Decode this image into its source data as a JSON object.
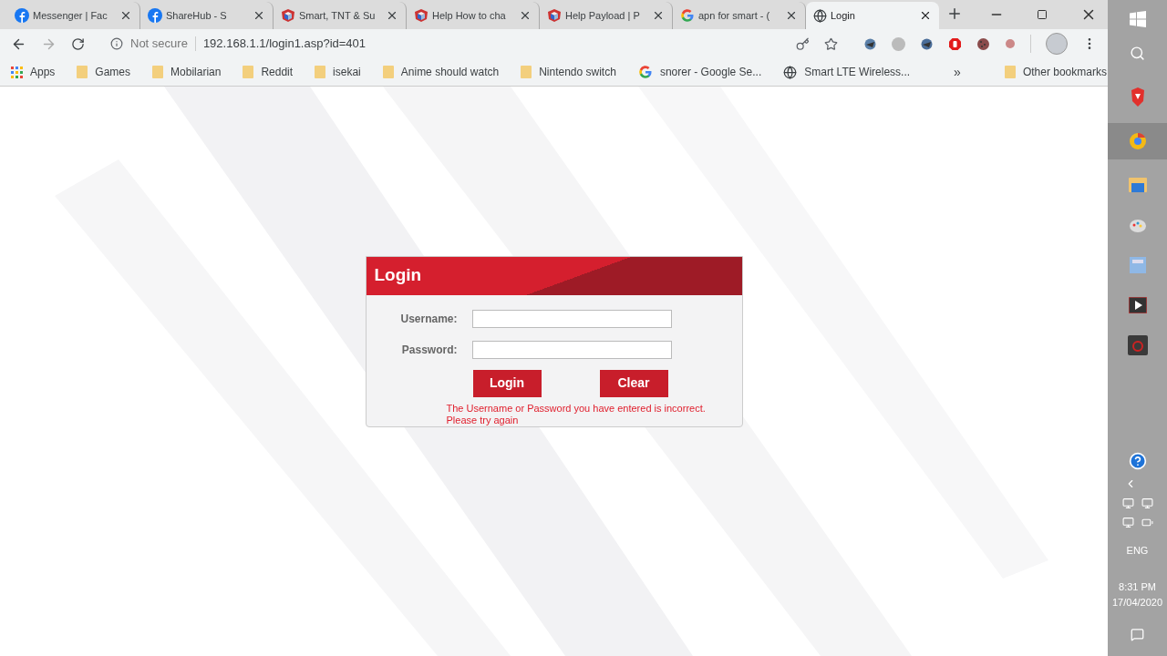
{
  "tabs": [
    {
      "label": "Messenger | Fac",
      "kind": "facebook",
      "selected": false
    },
    {
      "label": "ShareHub - S",
      "kind": "facebook",
      "selected": false
    },
    {
      "label": "Smart, TNT & Su",
      "kind": "cube",
      "selected": false
    },
    {
      "label": "Help How to cha",
      "kind": "cube",
      "selected": false
    },
    {
      "label": "Help Payload | P",
      "kind": "cube",
      "selected": false
    },
    {
      "label": "apn for smart - (",
      "kind": "google",
      "selected": false
    },
    {
      "label": "Login",
      "kind": "globe",
      "selected": true
    }
  ],
  "address_bar": {
    "security": "Not secure",
    "url": "192.168.1.1/login1.asp?id=401"
  },
  "bookmarks": [
    {
      "label": "Apps",
      "kind": "apps"
    },
    {
      "label": "Games",
      "kind": "folder"
    },
    {
      "label": "Mobilarian",
      "kind": "folder"
    },
    {
      "label": "Reddit",
      "kind": "folder"
    },
    {
      "label": "isekai",
      "kind": "folder"
    },
    {
      "label": "Anime should watch",
      "kind": "folder"
    },
    {
      "label": "Nintendo switch",
      "kind": "folder"
    },
    {
      "label": "snorer - Google Se...",
      "kind": "google"
    },
    {
      "label": "Smart LTE Wireless...",
      "kind": "globe"
    }
  ],
  "overflow": "»",
  "other_bookmarks": "Other bookmarks",
  "login": {
    "title": "Login",
    "fields": [
      {
        "label": "Username:"
      },
      {
        "label": "Password:"
      }
    ],
    "buttons": [
      "Login",
      "Clear"
    ],
    "error": [
      "The Username or Password you have entered is incorrect.",
      "Please try again"
    ]
  },
  "tray": {
    "language": "ENG",
    "time": "8:31 PM",
    "date": "17/04/2020"
  }
}
